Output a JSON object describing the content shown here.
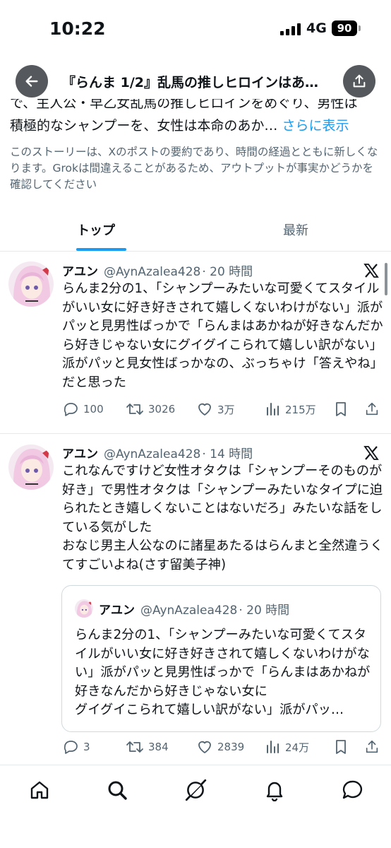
{
  "status_bar": {
    "time": "10:22",
    "network": "4G",
    "battery": "90"
  },
  "header": {
    "title": "『らんま 1/2』乱馬の推しヒロインはあ…"
  },
  "summary": {
    "line1_cut": "で、主人公・早乙女乱馬の推しヒロインをめぐり、男性は",
    "line2": "積極的なシャンプーを、女性は本命のあか…",
    "more_label": "さらに表示",
    "disclaimer": "このストーリーは、Xのポストの要約であり、時間の経過とともに新しくなります。Grokは間違えることがあるため、アウトプットが事実かどうかを確認してください"
  },
  "tabs": [
    {
      "label": "トップ"
    },
    {
      "label": "最新"
    }
  ],
  "posts": [
    {
      "author": "アユン",
      "handle": "@AynAzalea428",
      "time": "· 20 時間",
      "text": "らんま2分の1、「シャンプーみたいな可愛くてスタイルがいい女に好き好きされて嬉しくないわけがない」派がパッと見男性ばっかで「らんまはあかねが好きなんだから好きじゃない女にグイグイこられて嬉しい訳がない」派がパッと見女性ばっかなの、ぶっちゃけ「答えやね」だと思った",
      "replies": "100",
      "reposts": "3026",
      "likes": "3万",
      "views": "215万"
    },
    {
      "author": "アユン",
      "handle": "@AynAzalea428",
      "time": "· 14 時間",
      "text": "これなんですけど女性オタクは「シャンプーそのものが好き」で男性オタクは「シャンプーみたいなタイプに迫られたとき嬉しくないことはないだろ」みたいな話をしている気がした\nおなじ男主人公なのに諸星あたるはらんまと全然違うくてすごいよね(さす留美子神)",
      "replies": "3",
      "reposts": "384",
      "likes": "2839",
      "views": "24万",
      "quote": {
        "author": "アユン",
        "handle": "@AynAzalea428",
        "time": "· 20 時間",
        "text_main": "らんま2分の1、「シャンプーみたいな可愛くてスタイルがいい女に好き好きされて嬉しくないわけがない」派がパッと見男性ばっかで「らんまはあかねが好きなんだから好きじゃない女に",
        "text_last": "グイグイこられて嬉しい訳がない」派がパッ…"
      }
    }
  ],
  "icons": {
    "back": "arrow-left-icon",
    "share": "share-icon",
    "x": "x-logo-icon",
    "reply": "reply-icon",
    "repost": "repost-icon",
    "like": "heart-icon",
    "views": "analytics-icon",
    "bookmark": "bookmark-icon",
    "nav": [
      "home-icon",
      "search-icon",
      "grok-icon",
      "notifications-icon",
      "messages-icon"
    ]
  },
  "colors": {
    "accent": "#1d9bf0",
    "text": "#0f1419",
    "secondary": "#536471"
  }
}
